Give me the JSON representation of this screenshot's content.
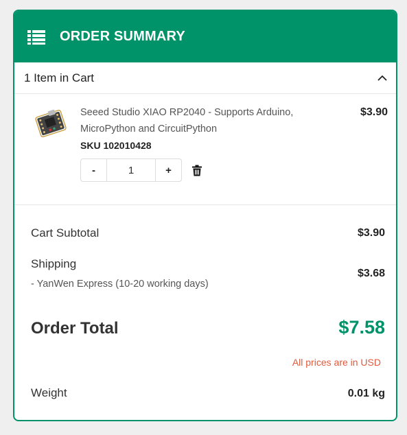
{
  "header": {
    "title": "ORDER SUMMARY",
    "icon": "list-icon"
  },
  "cart": {
    "count_label": "1 Item in Cart",
    "items": [
      {
        "name": "Seeed Studio XIAO RP2040 - Supports Arduino, MicroPython and CircuitPython",
        "price": "$3.90",
        "sku": "SKU 102010428",
        "qty": "1",
        "minus": "-",
        "plus": "+"
      }
    ]
  },
  "totals": {
    "subtotal_label": "Cart Subtotal",
    "subtotal_value": "$3.90",
    "shipping_label": "Shipping",
    "shipping_method": "- YanWen Express (10-20 working days)",
    "shipping_value": "$3.68",
    "order_total_label": "Order Total",
    "order_total_value": "$7.58",
    "currency_note": "All prices are in USD",
    "weight_label": "Weight",
    "weight_value": "0.01 kg"
  },
  "colors": {
    "brand": "#00936a",
    "note": "#e05a3c"
  }
}
